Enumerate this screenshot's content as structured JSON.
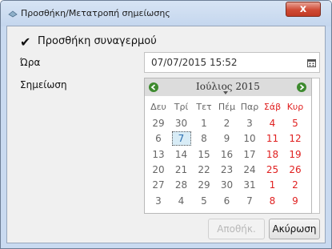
{
  "window": {
    "title": "Προσθήκη/Μετατροπή σημείωσης",
    "close_label": "x"
  },
  "form": {
    "alarm_label": "Προσθήκη συναγερμού",
    "alarm_checked": true,
    "time_label": "Ώρα",
    "note_label": "Σημείωση",
    "datetime_value": "07/07/2015 15:52"
  },
  "calendar": {
    "month_year": "Ιούλιος 2015",
    "weekdays": [
      "Δευ",
      "Τρί",
      "Τετ",
      "Πέμ",
      "Παρ",
      "Σάβ",
      "Κυρ"
    ],
    "weeks": [
      [
        "29",
        "30",
        "1",
        "2",
        "3",
        "4",
        "5"
      ],
      [
        "6",
        "7",
        "8",
        "9",
        "10",
        "11",
        "12"
      ],
      [
        "13",
        "14",
        "15",
        "16",
        "17",
        "18",
        "19"
      ],
      [
        "20",
        "21",
        "22",
        "23",
        "24",
        "25",
        "26"
      ],
      [
        "27",
        "28",
        "29",
        "30",
        "31",
        "1",
        "2"
      ],
      [
        "3",
        "4",
        "5",
        "6",
        "7",
        "8",
        "9"
      ]
    ],
    "selected_day": "7"
  },
  "buttons": {
    "ok_label": "Αποθήκ.",
    "cancel_label": "Ακύρωση"
  },
  "colors": {
    "weekend": "#e02020",
    "nav": "#3d8a2e",
    "selected_bg": "#d8ecf6"
  }
}
